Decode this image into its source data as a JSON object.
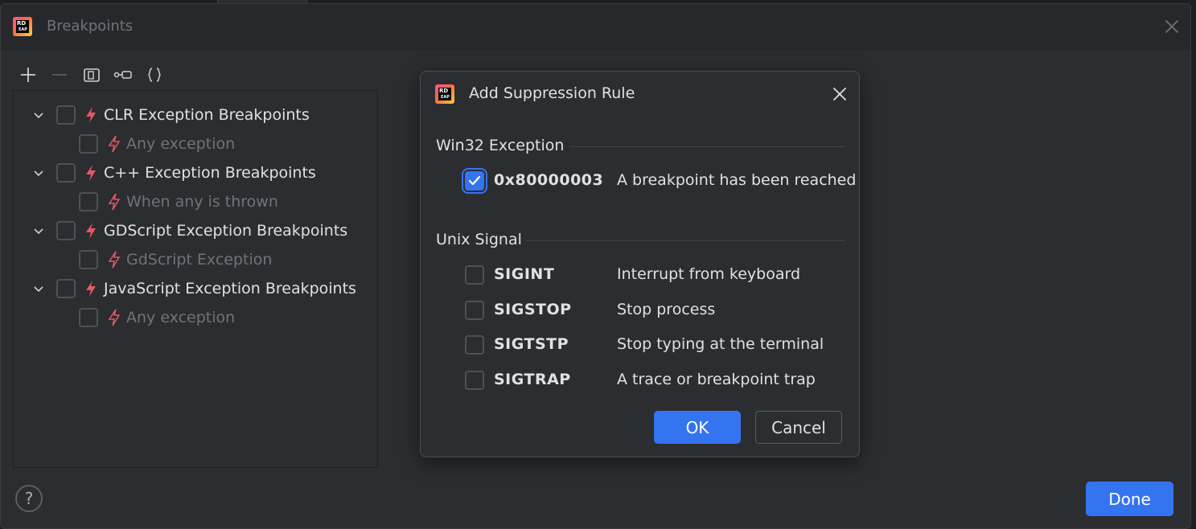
{
  "window": {
    "title": "Breakpoints",
    "logo_top": "RD",
    "logo_bottom": "EAP"
  },
  "toolbar": {
    "add_icon": "plus-icon",
    "remove_icon": "minus-icon",
    "group_icon": "group-icon",
    "link_icon": "link-icon",
    "braces_icon": "braces-icon"
  },
  "tree": [
    {
      "label": "CLR Exception Breakpoints",
      "child": "Any exception"
    },
    {
      "label": "C++ Exception Breakpoints",
      "child": "When any is thrown"
    },
    {
      "label": "GDScript Exception Breakpoints",
      "child": "GdScript Exception"
    },
    {
      "label": "JavaScript Exception Breakpoints",
      "child": "Any exception"
    }
  ],
  "help_label": "?",
  "done_label": "Done",
  "dialog": {
    "title": "Add Suppression Rule",
    "win32": {
      "title": "Win32 Exception",
      "items": [
        {
          "code": "0x80000003",
          "desc": "A breakpoint has been reached",
          "checked": true
        }
      ]
    },
    "unix": {
      "title": "Unix Signal",
      "items": [
        {
          "code": "SIGINT",
          "desc": "Interrupt from keyboard",
          "checked": false
        },
        {
          "code": "SIGSTOP",
          "desc": "Stop process",
          "checked": false
        },
        {
          "code": "SIGTSTP",
          "desc": "Stop typing at the terminal",
          "checked": false
        },
        {
          "code": "SIGTRAP",
          "desc": "A trace or breakpoint trap",
          "checked": false
        }
      ]
    },
    "ok_label": "OK",
    "cancel_label": "Cancel"
  },
  "colors": {
    "accent": "#3574f0",
    "bolt": "#e55765",
    "background": "#2b2d30"
  }
}
